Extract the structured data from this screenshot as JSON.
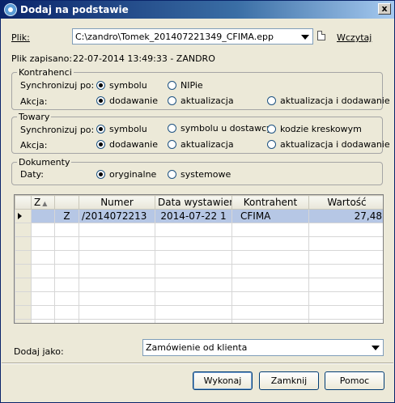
{
  "window": {
    "title": "Dodaj na podstawie",
    "close_glyph": "x"
  },
  "file": {
    "label": "Plik:",
    "path": "C:\\zandro\\Tomek_201407221349_CFIMA.epp",
    "load_label": "Wczytaj",
    "saved_label": "Plik zapisano:",
    "saved_value": "22-07-2014 13:49:33 - ZANDRO",
    "file_icon": "document-icon"
  },
  "kontrahenci": {
    "legend": "Kontrahenci",
    "sync_label": "Synchronizuj po:",
    "sync_options": [
      "symbolu",
      "NIPie"
    ],
    "action_label": "Akcja:",
    "action_options": [
      "dodawanie",
      "aktualizacja",
      "aktualizacja i dodawanie"
    ]
  },
  "towary": {
    "legend": "Towary",
    "sync_label": "Synchronizuj po:",
    "sync_options": [
      "symbolu",
      "symbolu u dostawcy",
      "kodzie kreskowym"
    ],
    "action_label": "Akcja:",
    "action_options": [
      "dodawanie",
      "aktualizacja",
      "aktualizacja i dodawanie"
    ]
  },
  "dokumenty": {
    "legend": "Dokumenty",
    "dates_label": "Daty:",
    "dates_options": [
      "oryginalne",
      "systemowe"
    ]
  },
  "grid": {
    "columns": [
      "",
      "Z",
      "Numer",
      "Data wystawien",
      "Kontrahent",
      "Wartość"
    ],
    "rows": [
      {
        "z": "Z",
        "numer": "/2014072213",
        "data": "2014-07-22 1",
        "kontrahent": "CFIMA",
        "wartosc": "27,48"
      }
    ]
  },
  "add_as": {
    "label": "Dodaj jako:",
    "value": "Zamówienie od klienta"
  },
  "buttons": {
    "execute": "Wykonaj",
    "close": "Zamknij",
    "help": "Pomoc"
  },
  "colors": {
    "title_bar": "#0a246a",
    "selection": "#b6c7e5",
    "dialog_bg": "#ece9d8"
  }
}
